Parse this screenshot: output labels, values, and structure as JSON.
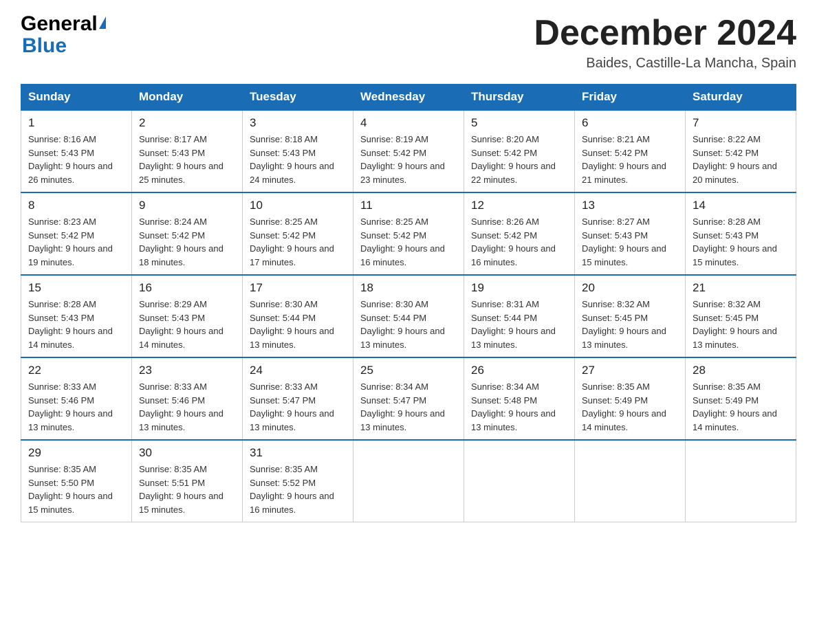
{
  "header": {
    "logo_general": "General",
    "logo_blue": "Blue",
    "month_title": "December 2024",
    "subtitle": "Baides, Castille-La Mancha, Spain"
  },
  "weekdays": [
    "Sunday",
    "Monday",
    "Tuesday",
    "Wednesday",
    "Thursday",
    "Friday",
    "Saturday"
  ],
  "weeks": [
    [
      {
        "day": "1",
        "sunrise": "8:16 AM",
        "sunset": "5:43 PM",
        "daylight": "9 hours and 26 minutes."
      },
      {
        "day": "2",
        "sunrise": "8:17 AM",
        "sunset": "5:43 PM",
        "daylight": "9 hours and 25 minutes."
      },
      {
        "day": "3",
        "sunrise": "8:18 AM",
        "sunset": "5:43 PM",
        "daylight": "9 hours and 24 minutes."
      },
      {
        "day": "4",
        "sunrise": "8:19 AM",
        "sunset": "5:42 PM",
        "daylight": "9 hours and 23 minutes."
      },
      {
        "day": "5",
        "sunrise": "8:20 AM",
        "sunset": "5:42 PM",
        "daylight": "9 hours and 22 minutes."
      },
      {
        "day": "6",
        "sunrise": "8:21 AM",
        "sunset": "5:42 PM",
        "daylight": "9 hours and 21 minutes."
      },
      {
        "day": "7",
        "sunrise": "8:22 AM",
        "sunset": "5:42 PM",
        "daylight": "9 hours and 20 minutes."
      }
    ],
    [
      {
        "day": "8",
        "sunrise": "8:23 AM",
        "sunset": "5:42 PM",
        "daylight": "9 hours and 19 minutes."
      },
      {
        "day": "9",
        "sunrise": "8:24 AM",
        "sunset": "5:42 PM",
        "daylight": "9 hours and 18 minutes."
      },
      {
        "day": "10",
        "sunrise": "8:25 AM",
        "sunset": "5:42 PM",
        "daylight": "9 hours and 17 minutes."
      },
      {
        "day": "11",
        "sunrise": "8:25 AM",
        "sunset": "5:42 PM",
        "daylight": "9 hours and 16 minutes."
      },
      {
        "day": "12",
        "sunrise": "8:26 AM",
        "sunset": "5:42 PM",
        "daylight": "9 hours and 16 minutes."
      },
      {
        "day": "13",
        "sunrise": "8:27 AM",
        "sunset": "5:43 PM",
        "daylight": "9 hours and 15 minutes."
      },
      {
        "day": "14",
        "sunrise": "8:28 AM",
        "sunset": "5:43 PM",
        "daylight": "9 hours and 15 minutes."
      }
    ],
    [
      {
        "day": "15",
        "sunrise": "8:28 AM",
        "sunset": "5:43 PM",
        "daylight": "9 hours and 14 minutes."
      },
      {
        "day": "16",
        "sunrise": "8:29 AM",
        "sunset": "5:43 PM",
        "daylight": "9 hours and 14 minutes."
      },
      {
        "day": "17",
        "sunrise": "8:30 AM",
        "sunset": "5:44 PM",
        "daylight": "9 hours and 13 minutes."
      },
      {
        "day": "18",
        "sunrise": "8:30 AM",
        "sunset": "5:44 PM",
        "daylight": "9 hours and 13 minutes."
      },
      {
        "day": "19",
        "sunrise": "8:31 AM",
        "sunset": "5:44 PM",
        "daylight": "9 hours and 13 minutes."
      },
      {
        "day": "20",
        "sunrise": "8:32 AM",
        "sunset": "5:45 PM",
        "daylight": "9 hours and 13 minutes."
      },
      {
        "day": "21",
        "sunrise": "8:32 AM",
        "sunset": "5:45 PM",
        "daylight": "9 hours and 13 minutes."
      }
    ],
    [
      {
        "day": "22",
        "sunrise": "8:33 AM",
        "sunset": "5:46 PM",
        "daylight": "9 hours and 13 minutes."
      },
      {
        "day": "23",
        "sunrise": "8:33 AM",
        "sunset": "5:46 PM",
        "daylight": "9 hours and 13 minutes."
      },
      {
        "day": "24",
        "sunrise": "8:33 AM",
        "sunset": "5:47 PM",
        "daylight": "9 hours and 13 minutes."
      },
      {
        "day": "25",
        "sunrise": "8:34 AM",
        "sunset": "5:47 PM",
        "daylight": "9 hours and 13 minutes."
      },
      {
        "day": "26",
        "sunrise": "8:34 AM",
        "sunset": "5:48 PM",
        "daylight": "9 hours and 13 minutes."
      },
      {
        "day": "27",
        "sunrise": "8:35 AM",
        "sunset": "5:49 PM",
        "daylight": "9 hours and 14 minutes."
      },
      {
        "day": "28",
        "sunrise": "8:35 AM",
        "sunset": "5:49 PM",
        "daylight": "9 hours and 14 minutes."
      }
    ],
    [
      {
        "day": "29",
        "sunrise": "8:35 AM",
        "sunset": "5:50 PM",
        "daylight": "9 hours and 15 minutes."
      },
      {
        "day": "30",
        "sunrise": "8:35 AM",
        "sunset": "5:51 PM",
        "daylight": "9 hours and 15 minutes."
      },
      {
        "day": "31",
        "sunrise": "8:35 AM",
        "sunset": "5:52 PM",
        "daylight": "9 hours and 16 minutes."
      },
      null,
      null,
      null,
      null
    ]
  ]
}
